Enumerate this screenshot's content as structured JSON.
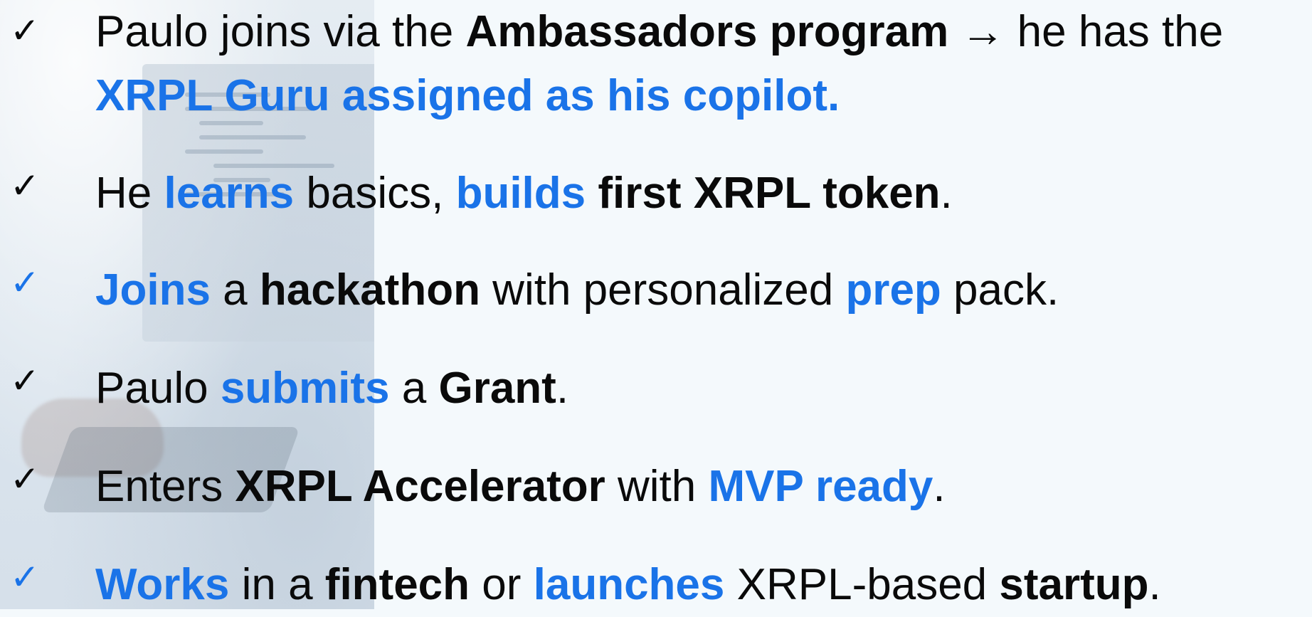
{
  "colors": {
    "text": "#0a0a0a",
    "accent_blue": "#1a73e8",
    "check_black": "#0a0a0a",
    "check_blue": "#1a73e8"
  },
  "items": [
    {
      "check_color": "black",
      "segments": [
        {
          "text": "Paulo joins via the ",
          "style": "normal"
        },
        {
          "text": "Ambassadors program",
          "style": "bold"
        },
        {
          "text": " → he has the",
          "style": "normal"
        }
      ],
      "line2": [
        {
          "text": "XRPL Guru assigned as his copilot.",
          "style": "blue-bold"
        }
      ]
    },
    {
      "check_color": "black",
      "segments": [
        {
          "text": "He ",
          "style": "normal"
        },
        {
          "text": "learns",
          "style": "blue-bold"
        },
        {
          "text": " basics, ",
          "style": "normal"
        },
        {
          "text": "builds",
          "style": "blue-bold"
        },
        {
          "text": " ",
          "style": "normal"
        },
        {
          "text": "first XRPL token",
          "style": "bold"
        },
        {
          "text": ".",
          "style": "normal"
        }
      ]
    },
    {
      "check_color": "blue",
      "segments": [
        {
          "text": "Joins",
          "style": "blue-bold"
        },
        {
          "text": " a ",
          "style": "normal"
        },
        {
          "text": "hackathon",
          "style": "bold"
        },
        {
          "text": " with personalized ",
          "style": "normal"
        },
        {
          "text": "prep",
          "style": "blue-bold"
        },
        {
          "text": " pack.",
          "style": "normal"
        }
      ]
    },
    {
      "check_color": "black",
      "segments": [
        {
          "text": "Paulo ",
          "style": "normal"
        },
        {
          "text": "submits",
          "style": "blue-bold"
        },
        {
          "text": " a ",
          "style": "normal"
        },
        {
          "text": "Grant",
          "style": "bold"
        },
        {
          "text": ".",
          "style": "normal"
        }
      ]
    },
    {
      "check_color": "black",
      "segments": [
        {
          "text": "Enters ",
          "style": "normal"
        },
        {
          "text": "XRPL Accelerator",
          "style": "bold"
        },
        {
          "text": " with ",
          "style": "normal"
        },
        {
          "text": "MVP ready",
          "style": "blue-bold"
        },
        {
          "text": ".",
          "style": "normal"
        }
      ]
    },
    {
      "check_color": "blue",
      "segments": [
        {
          "text": "Works",
          "style": "blue-bold"
        },
        {
          "text": " in a ",
          "style": "normal"
        },
        {
          "text": "fintech",
          "style": "bold"
        },
        {
          "text": " or ",
          "style": "normal"
        },
        {
          "text": "launches",
          "style": "blue-bold"
        },
        {
          "text": " XRPL-based ",
          "style": "normal"
        },
        {
          "text": "startup",
          "style": "bold"
        },
        {
          "text": ".",
          "style": "normal"
        }
      ]
    }
  ],
  "check_glyph": "✓"
}
